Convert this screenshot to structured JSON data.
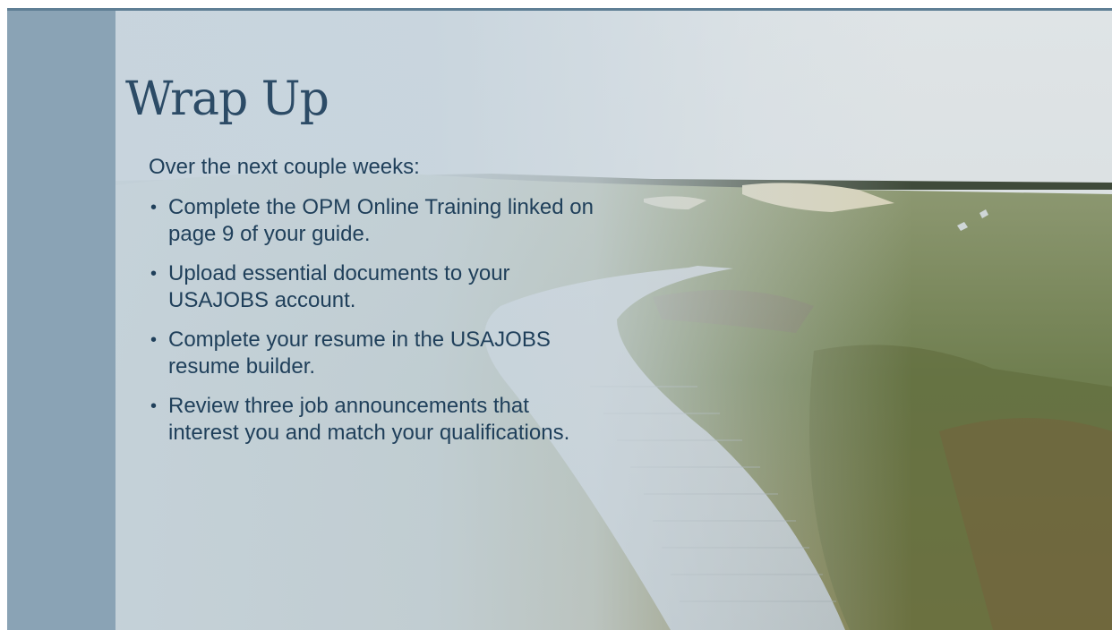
{
  "slide": {
    "title": "Wrap Up",
    "intro": "Over the next couple weeks:",
    "bullets": [
      "Complete the OPM Online Training linked on page 9 of your guide.",
      "Upload essential documents to your USAJOBS account.",
      "Complete your resume in the USAJOBS resume builder.",
      "Review three job announcements that interest you and match your qualifications."
    ]
  },
  "colors": {
    "title": "#2c4b66",
    "body_text": "#1f3f5a",
    "left_band": "#8aa3b5",
    "top_rule": "#5f7f95"
  },
  "icons": {
    "bullet": "bullet-dot-icon"
  }
}
